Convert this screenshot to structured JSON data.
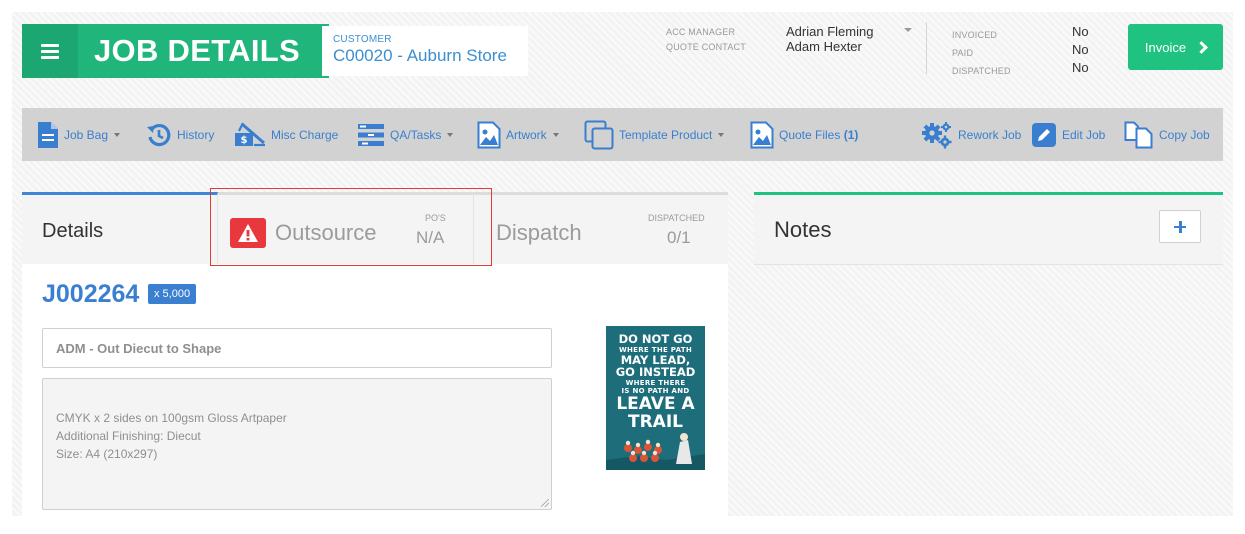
{
  "header": {
    "title": "JOB DETAILS",
    "customer_label": "CUSTOMER",
    "customer_value": "C00020 - Auburn Store",
    "acc_manager_label": "ACC MANAGER",
    "acc_manager_value": "Adrian Fleming",
    "quote_contact_label": "QUOTE CONTACT",
    "quote_contact_value": "Adam Hexter",
    "invoiced_label": "INVOICED",
    "invoiced_value": "No",
    "paid_label": "PAID",
    "paid_value": "No",
    "dispatched_label": "DISPATCHED",
    "dispatched_value": "No",
    "invoice_button": "Invoice"
  },
  "toolbar": {
    "job_bag": "Job Bag",
    "history": "History",
    "misc_charge": "Misc Charge",
    "qa_tasks": "QA/Tasks",
    "artwork": "Artwork",
    "template_product": "Template Product",
    "quote_files": "Quote Files",
    "quote_files_count": "(1)",
    "rework_job": "Rework Job",
    "edit_job": "Edit Job",
    "copy_job": "Copy Job"
  },
  "tabs": {
    "details": "Details",
    "outsource": "Outsource",
    "outsource_count_label": "PO'S",
    "outsource_count": "N/A",
    "dispatch": "Dispatch",
    "dispatch_count_label": "DISPATCHED",
    "dispatch_count": "0/1"
  },
  "job": {
    "number": "J002264",
    "quantity": "x 5,000",
    "title": "ADM - Out Diecut to Shape",
    "description": "CMYK x 2 sides  on 100gsm Gloss Artpaper\nAdditional Finishing: Diecut\nSize: A4 (210x297)"
  },
  "artwork": {
    "line1": "DO NOT GO",
    "line2": "WHERE THE PATH",
    "line3": "MAY LEAD,",
    "line4": "GO INSTEAD",
    "line5": "WHERE THERE",
    "line6": "IS NO PATH AND",
    "line7": "LEAVE A",
    "line8": "TRAIL"
  },
  "notes": {
    "title": "Notes"
  },
  "colors": {
    "brand_green": "#1fb57b",
    "accent_blue": "#3b7fd1",
    "warning_red": "#e8383d"
  }
}
